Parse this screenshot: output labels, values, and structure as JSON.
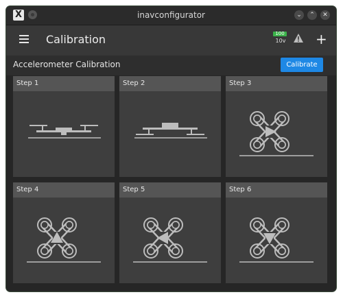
{
  "window": {
    "title": "inavconfigurator"
  },
  "app_logo": "X",
  "header": {
    "title": "Calibration",
    "battery_percent": "100",
    "battery_voltage": "10v"
  },
  "section": {
    "title": "Accelerometer Calibration",
    "calibrate_label": "Calibrate"
  },
  "steps": [
    {
      "label": "Step 1"
    },
    {
      "label": "Step 2"
    },
    {
      "label": "Step 3"
    },
    {
      "label": "Step 4"
    },
    {
      "label": "Step 5"
    },
    {
      "label": "Step 6"
    }
  ]
}
